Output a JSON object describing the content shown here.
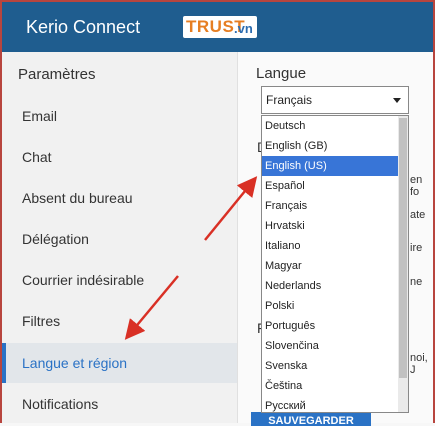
{
  "header": {
    "title": "Kerio Connect",
    "logo": {
      "trust": "TRUST",
      "vn": ".vn"
    }
  },
  "sidebar": {
    "title": "Paramètres",
    "items": [
      {
        "label": "Email"
      },
      {
        "label": "Chat"
      },
      {
        "label": "Absent du bureau"
      },
      {
        "label": "Délégation"
      },
      {
        "label": "Courrier indésirable"
      },
      {
        "label": "Filtres"
      },
      {
        "label": "Langue et région",
        "active": true
      },
      {
        "label": "Notifications"
      }
    ]
  },
  "main": {
    "language_label": "Langue",
    "language_select": {
      "value": "Français"
    },
    "options": [
      "Deutsch",
      "English (GB)",
      "English (US)",
      "Español",
      "Français",
      "Hrvatski",
      "Italiano",
      "Magyar",
      "Nederlands",
      "Polski",
      "Português",
      "Slovenčina",
      "Svenska",
      "Čeština",
      "Русский"
    ],
    "highlighted_option": "English (US)",
    "behind_text": [
      "D",
      "en fo",
      "ate",
      "ire",
      "ne",
      "F",
      "noi, J"
    ],
    "save_button": "SAUVEGARDER"
  },
  "colors": {
    "header": "#1f5d8f",
    "accent": "#2a72c5",
    "annotation": "#d93025"
  }
}
